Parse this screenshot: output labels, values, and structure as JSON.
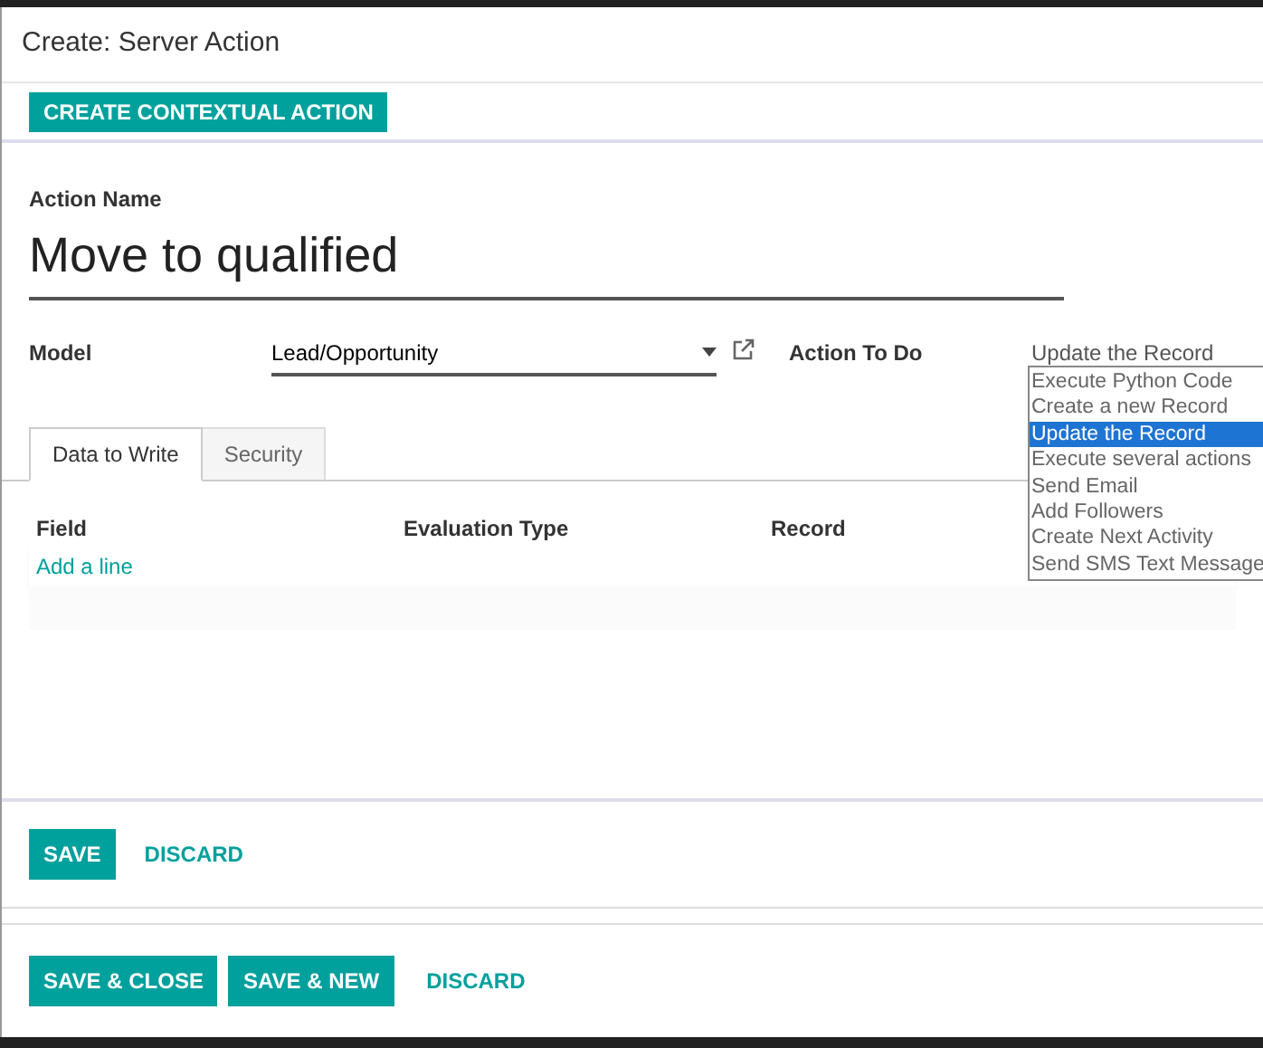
{
  "dialog": {
    "title": "Create: Server Action"
  },
  "header_button": "CREATE CONTEXTUAL ACTION",
  "action_name": {
    "label": "Action Name",
    "value": "Move to qualified"
  },
  "model": {
    "label": "Model",
    "value": "Lead/Opportunity"
  },
  "action_to_do": {
    "label": "Action To Do",
    "value": "Update the Record",
    "options": [
      {
        "label": "Execute Python Code",
        "selected": false
      },
      {
        "label": "Create a new Record",
        "selected": false
      },
      {
        "label": "Update the Record",
        "selected": true
      },
      {
        "label": "Execute several actions",
        "selected": false
      },
      {
        "label": "Send Email",
        "selected": false
      },
      {
        "label": "Add Followers",
        "selected": false
      },
      {
        "label": "Create Next Activity",
        "selected": false
      },
      {
        "label": "Send SMS Text Message",
        "selected": false
      }
    ]
  },
  "tabs": [
    {
      "label": "Data to Write",
      "selected": true
    },
    {
      "label": "Security",
      "selected": false
    }
  ],
  "table": {
    "columns": [
      "Field",
      "Evaluation Type",
      "Record"
    ],
    "add_line": "Add a line"
  },
  "form_buttons": [
    {
      "label": "SAVE",
      "kind": "primary"
    },
    {
      "label": "DISCARD",
      "kind": "link"
    }
  ],
  "footer_buttons": [
    {
      "label": "SAVE & CLOSE",
      "kind": "primary"
    },
    {
      "label": "SAVE & NEW",
      "kind": "primary"
    },
    {
      "label": "DISCARD",
      "kind": "link"
    }
  ]
}
